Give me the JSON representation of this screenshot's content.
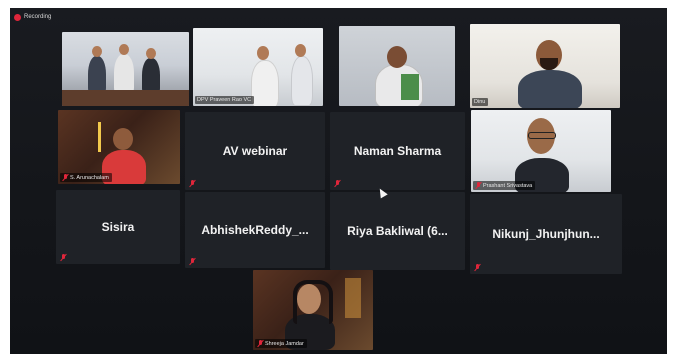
{
  "recording": {
    "label": "Recording",
    "color": "#e0263b"
  },
  "participants": [
    {
      "id": "p1",
      "name": "",
      "muted": false
    },
    {
      "id": "p2",
      "name": "DPV Praveen Rao VC",
      "muted": false
    },
    {
      "id": "p3",
      "name": "",
      "muted": false
    },
    {
      "id": "p4",
      "name": "Dinu",
      "muted": false
    },
    {
      "id": "p5",
      "name": "S. Arunachalam",
      "muted": true
    },
    {
      "id": "p6",
      "name": "AV webinar",
      "muted": true
    },
    {
      "id": "p7",
      "name": "Naman Sharma",
      "muted": true
    },
    {
      "id": "p8",
      "name": "Prashant Srivastava",
      "muted": true
    },
    {
      "id": "p9",
      "name": "Sisira",
      "muted": true
    },
    {
      "id": "p10",
      "name": "AbhishekReddy_...",
      "muted": true
    },
    {
      "id": "p11",
      "name": "Riya Bakliwal (6...",
      "muted": false
    },
    {
      "id": "p12",
      "name": "Nikunj_Jhunjhun...",
      "muted": true
    },
    {
      "id": "p13",
      "name": "Shreeja Jamdar",
      "muted": true
    }
  ],
  "icons": {
    "muted": "mic-off-icon",
    "recording": "record-dot-icon",
    "pointer": "cursor-arrow-icon"
  }
}
